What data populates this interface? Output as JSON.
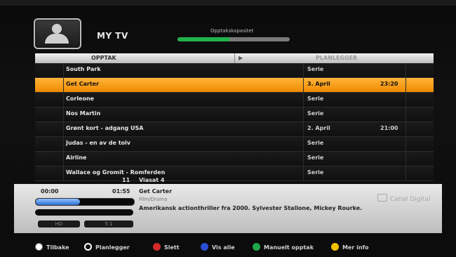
{
  "header": {
    "title": "MY TV",
    "capacity_label": "Opptakskapasitet",
    "capacity_used": 0.47
  },
  "tabs": {
    "recordings": "OPPTAK",
    "arrow": "▶",
    "scheduled": "PLANLEGGER"
  },
  "recordings": [
    {
      "name": "South Park",
      "category": "Serie",
      "time": ""
    },
    {
      "name": "Get Carter",
      "category": "3. April",
      "time": "23:20",
      "selected": true
    },
    {
      "name": "Corleone",
      "category": "Serie",
      "time": ""
    },
    {
      "name": "Nos Martin",
      "category": "Serie",
      "time": ""
    },
    {
      "name": "Grønt kort - adgang USA",
      "category": "2. April",
      "time": "21:00"
    },
    {
      "name": "Judas - en av de tolv",
      "category": "Serie",
      "time": ""
    },
    {
      "name": "Airline",
      "category": "Serie",
      "time": ""
    },
    {
      "name": "Wallace og Gromit - Romferden",
      "category": "Serie",
      "time": ""
    }
  ],
  "channel": {
    "number": "11",
    "name": "Viasat 4"
  },
  "info": {
    "start": "00:00",
    "end": "01:55",
    "title": "Get Carter",
    "genre": "Film/Drama",
    "description": "Amerikansk actionthriller fra 2000. Sylvester Stallone, Mickey Rourke.",
    "progress": 0.45,
    "hd": "HD",
    "ratio": "5:1",
    "brand": "Canal Digital"
  },
  "footer": [
    {
      "label": "Tilbake",
      "icon": "white",
      "color": "#ffffff"
    },
    {
      "label": "Planlegger",
      "icon": "outline",
      "color": "#ffffff"
    },
    {
      "label": "Slett",
      "icon": "red",
      "color": "#d42a2a"
    },
    {
      "label": "Vis alle",
      "icon": "blue",
      "color": "#2a4fd4"
    },
    {
      "label": "Manuelt opptak",
      "icon": "green",
      "color": "#1ea84a"
    },
    {
      "label": "Mer info",
      "icon": "yellow",
      "color": "#f2c200"
    }
  ]
}
